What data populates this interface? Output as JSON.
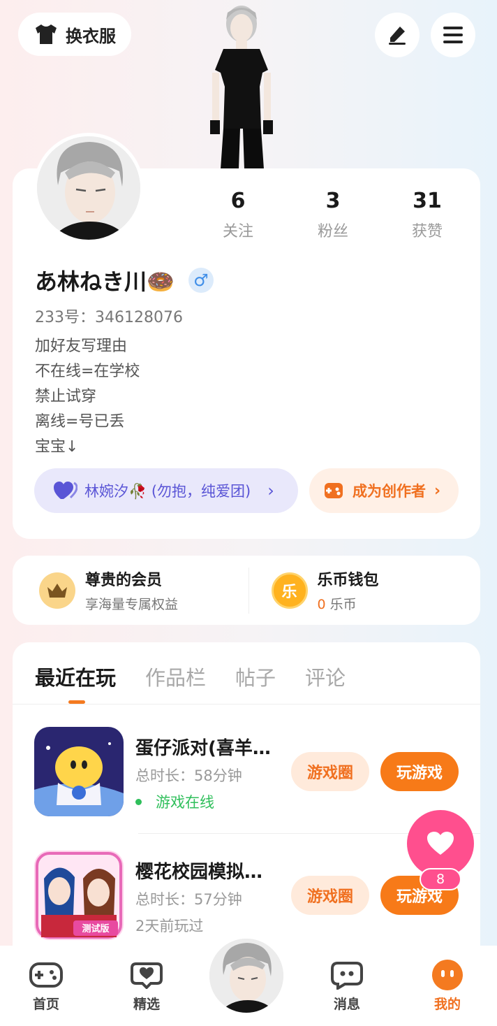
{
  "header": {
    "outfit_label": "换衣服",
    "edit_icon": "pencil-icon",
    "menu_icon": "menu-icon"
  },
  "profile": {
    "stats": [
      {
        "value": "6",
        "label": "关注"
      },
      {
        "value": "3",
        "label": "粉丝"
      },
      {
        "value": "31",
        "label": "获赞"
      }
    ],
    "username": "あ林ねき川🍩",
    "gender_symbol": "♂",
    "uid": "233号：346128076",
    "bio": [
      "加好友写理由",
      "不在线=在学校",
      "禁止试穿",
      "离线=号已丢",
      "宝宝↓"
    ],
    "cp_label": "林婉汐🥀 (勿抱，纯爱团)",
    "creator_label": "成为创作者"
  },
  "vip": {
    "title": "尊贵的会员",
    "subtitle": "享海量专属权益"
  },
  "wallet": {
    "title": "乐币钱包",
    "coin_glyph": "乐",
    "amount": "0",
    "unit": "乐币"
  },
  "tabs": [
    "最近在玩",
    "作品栏",
    "帖子",
    "评论"
  ],
  "games": [
    {
      "name": "蛋仔派对(喜羊…",
      "time": "总时长：58分钟",
      "status": "游戏在线",
      "online": true,
      "circle_label": "游戏圈",
      "play_label": "玩游戏"
    },
    {
      "name": "樱花校园模拟…",
      "time": "总时长：57分钟",
      "status": "2天前玩过",
      "online": false,
      "circle_label": "游戏圈",
      "play_label": "玩游戏"
    }
  ],
  "floating": {
    "badge": "8"
  },
  "bottom_nav": [
    {
      "label": "首页",
      "icon": "gamepad-icon"
    },
    {
      "label": "精选",
      "icon": "heart-chat-icon"
    },
    {
      "label": "消息",
      "icon": "message-icon"
    },
    {
      "label": "我的",
      "icon": "profile-face-icon",
      "active": true
    }
  ],
  "colors": {
    "accent": "#f77a18",
    "pink": "#ff4f8e",
    "purple": "#5a55d6",
    "online": "#2fbf5b"
  }
}
